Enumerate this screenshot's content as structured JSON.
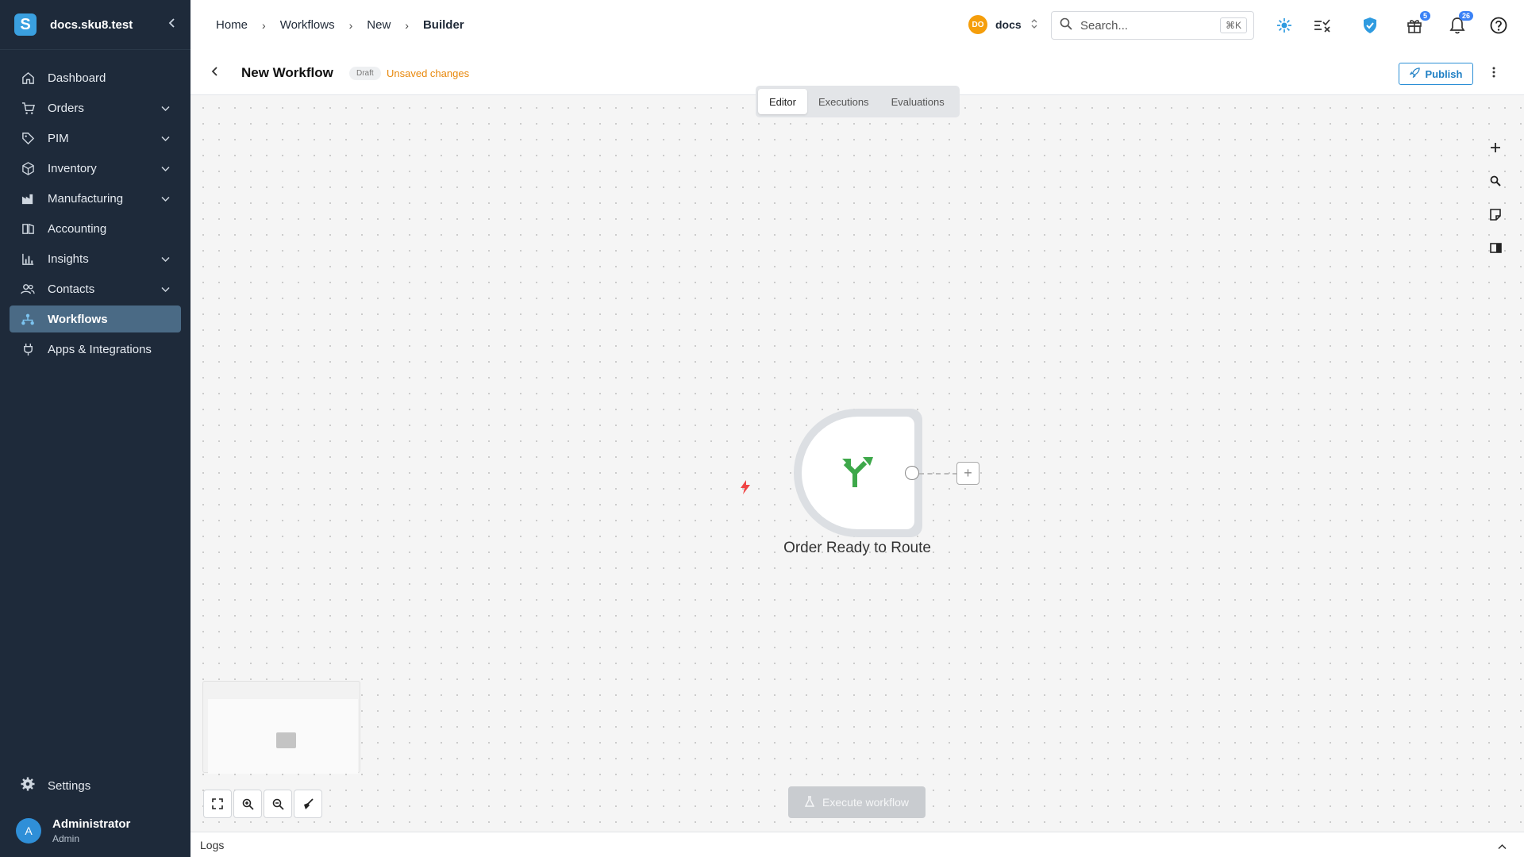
{
  "sidebar": {
    "org_name": "docs.sku8.test",
    "logo_letter": "S",
    "items": [
      {
        "label": "Dashboard",
        "icon": "home-icon",
        "expandable": false
      },
      {
        "label": "Orders",
        "icon": "cart-icon",
        "expandable": true
      },
      {
        "label": "PIM",
        "icon": "tag-icon",
        "expandable": true
      },
      {
        "label": "Inventory",
        "icon": "box-icon",
        "expandable": true
      },
      {
        "label": "Manufacturing",
        "icon": "factory-icon",
        "expandable": true
      },
      {
        "label": "Accounting",
        "icon": "ledger-icon",
        "expandable": false
      },
      {
        "label": "Insights",
        "icon": "bar-chart-icon",
        "expandable": true
      },
      {
        "label": "Contacts",
        "icon": "people-icon",
        "expandable": true
      },
      {
        "label": "Workflows",
        "icon": "workflow-icon",
        "expandable": false,
        "active": true
      },
      {
        "label": "Apps & Integrations",
        "icon": "plug-icon",
        "expandable": false
      }
    ],
    "settings_label": "Settings",
    "user": {
      "initial": "A",
      "name": "Administrator",
      "role": "Admin"
    }
  },
  "topbar": {
    "breadcrumbs": [
      "Home",
      "Workflows",
      "New",
      "Builder"
    ],
    "workspace": {
      "initials": "DO",
      "name": "docs"
    },
    "search": {
      "placeholder": "Search...",
      "shortcut": "⌘K"
    },
    "gift_badge": "5",
    "notifications_badge": "26"
  },
  "subheader": {
    "title": "New Workflow",
    "status": "Draft",
    "unsaved": "Unsaved changes",
    "publish_label": "Publish"
  },
  "tabs": [
    {
      "label": "Editor",
      "active": true
    },
    {
      "label": "Executions",
      "active": false
    },
    {
      "label": "Evaluations",
      "active": false
    }
  ],
  "node": {
    "label": "Order Ready to Route",
    "icon": "route-split-icon",
    "color": "#3ea84a"
  },
  "execute_label": "Execute workflow",
  "logs_label": "Logs",
  "colors": {
    "sidebar_bg": "#1e2a3a",
    "active_item": "#4a6a85",
    "accent": "#2b8fd6",
    "warning": "#e8880c"
  }
}
